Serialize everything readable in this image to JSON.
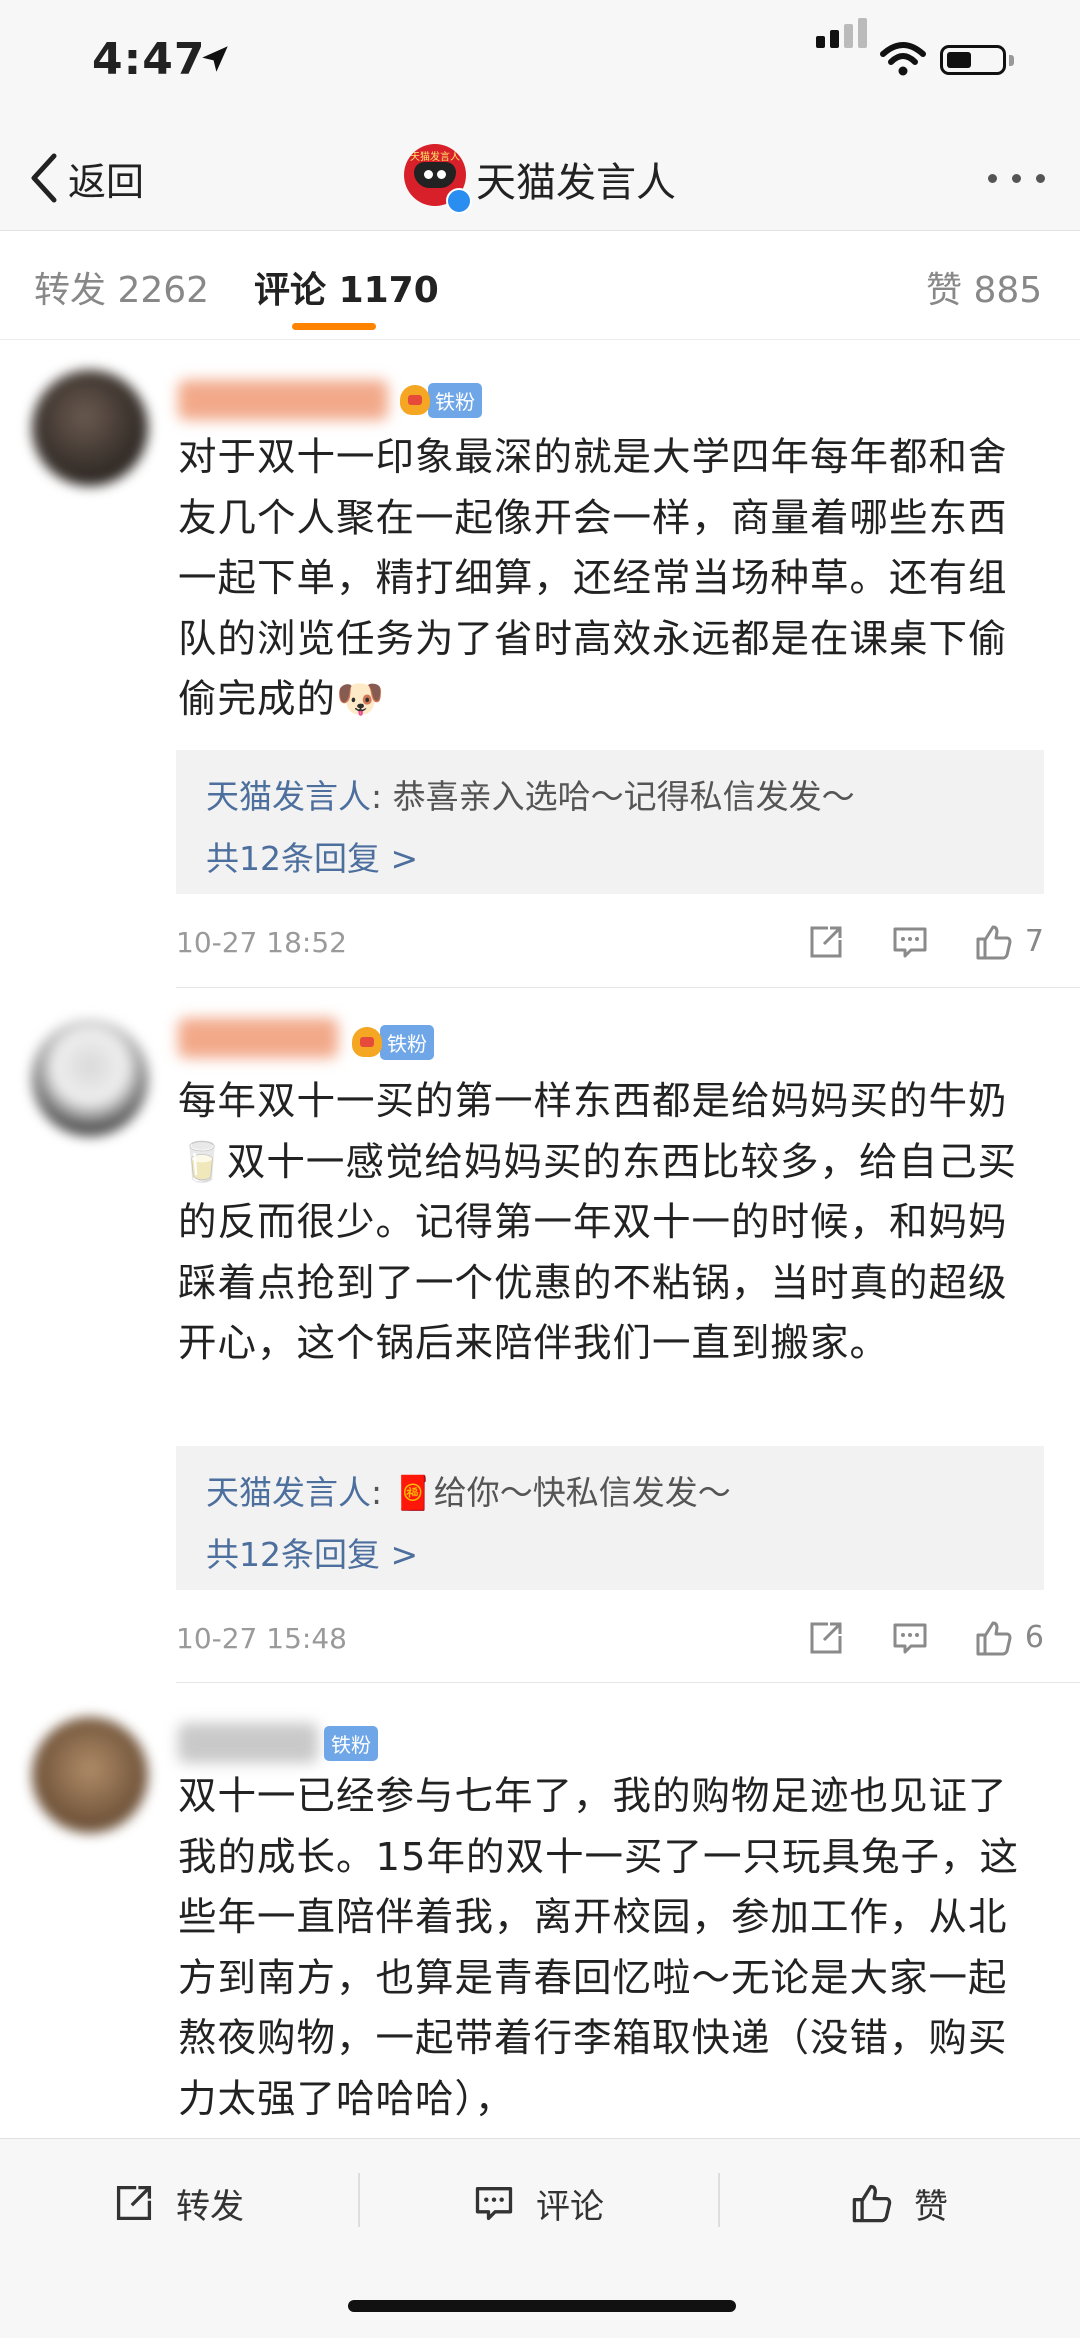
{
  "status_bar": {
    "time": "4:47"
  },
  "nav": {
    "back_label": "返回",
    "title": "天猫发言人",
    "avatar_text": "天猫发言人"
  },
  "tabs": [
    {
      "label": "转发",
      "count": "2262"
    },
    {
      "label": "评论",
      "count": "1170",
      "active": true
    },
    {
      "label": "赞",
      "count": "885"
    }
  ],
  "fan_badge": "铁粉",
  "comments": [
    {
      "text": "对于双十一印象最深的就是大学四年每年都和舍友几个人聚在一起像开会一样，商量着哪些东西一起下单，精打细算，还经常当场种草。还有组队的浏览任务为了省时高效永远都是在课桌下偷偷完成的🐶",
      "reply_author": "天猫发言人",
      "reply_text": "恭喜亲入选哈～记得私信发发～",
      "reply_more": "共12条回复 >",
      "time": "10-27 18:52",
      "likes": "7"
    },
    {
      "text": "每年双十一买的第一样东西都是给妈妈买的牛奶🥛双十一感觉给妈妈买的东西比较多，给自己买的反而很少。记得第一年双十一的时候，和妈妈踩着点抢到了一个优惠的不粘锅，当时真的超级开心，这个锅后来陪伴我们一直到搬家。",
      "reply_author": "天猫发言人",
      "reply_text": "🧧给你～快私信发发～",
      "reply_more": "共12条回复 >",
      "time": "10-27 15:48",
      "likes": "6"
    },
    {
      "text": "双十一已经参与七年了，我的购物足迹也见证了我的成长。15年的双十一买了一只玩具兔子，这些年一直陪伴着我，离开校园，参加工作，从北方到南方，也算是青春回忆啦～无论是大家一起熬夜购物，一起带着行李箱取快递（没错，购买力太强了哈哈哈），"
    }
  ],
  "bottom_bar": {
    "repost": "转发",
    "comment": "评论",
    "like": "赞"
  },
  "colors": {
    "accent": "#ff8200",
    "link": "#4d6f9e",
    "badge": "#6ea6e8"
  }
}
